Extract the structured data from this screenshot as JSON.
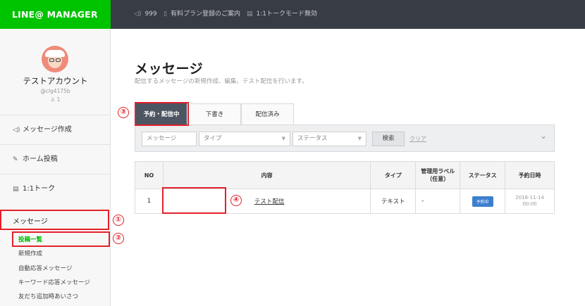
{
  "brand": "LINE@ MANAGER",
  "topbar": {
    "count": "999",
    "plan_link": "有料プラン登録のご案内",
    "mode": "1:1トークモード無効"
  },
  "account": {
    "name": "テストアカウント",
    "id": "@clg4175b",
    "members": "1"
  },
  "sidebar": {
    "items": [
      {
        "label": "メッセージ作成",
        "icon": "megaphone-icon"
      },
      {
        "label": "ホーム投稿",
        "icon": "edit-icon"
      },
      {
        "label": "1:1トーク",
        "icon": "chat-icon"
      }
    ],
    "message_section": "メッセージ",
    "sub_items": [
      "投稿一覧",
      "新規作成",
      "自動応答メッセージ",
      "キーワード応答メッセージ",
      "友だち追加時あいさつ"
    ]
  },
  "page": {
    "title": "メッセージ",
    "description": "配信するメッセージの新規作成、編集、テスト配信を行います。"
  },
  "tabs": [
    "予約・配信中",
    "下書き",
    "配信済み"
  ],
  "filter": {
    "message_placeholder": "メッセージ",
    "type_label": "タイプ",
    "status_label": "ステータス",
    "search_label": "検索",
    "clear_label": "クリア"
  },
  "table": {
    "headers": [
      "NO",
      "内容",
      "タイプ",
      "管理用ラベル\n（任意）",
      "ステータス",
      "予約日時"
    ],
    "rows": [
      {
        "no": "1",
        "content": "テスト配信",
        "type": "テキスト",
        "label": "-",
        "status": "予約中",
        "date": "2018-11-14",
        "time": "00:00"
      }
    ]
  },
  "annotations": [
    "①",
    "②",
    "③",
    "④"
  ],
  "colors": {
    "brand_green": "#00c300",
    "topbar": "#383c45",
    "active_tab": "#4e5562",
    "annotation_red": "#e3212b",
    "status_badge": "#3d7fcf"
  }
}
